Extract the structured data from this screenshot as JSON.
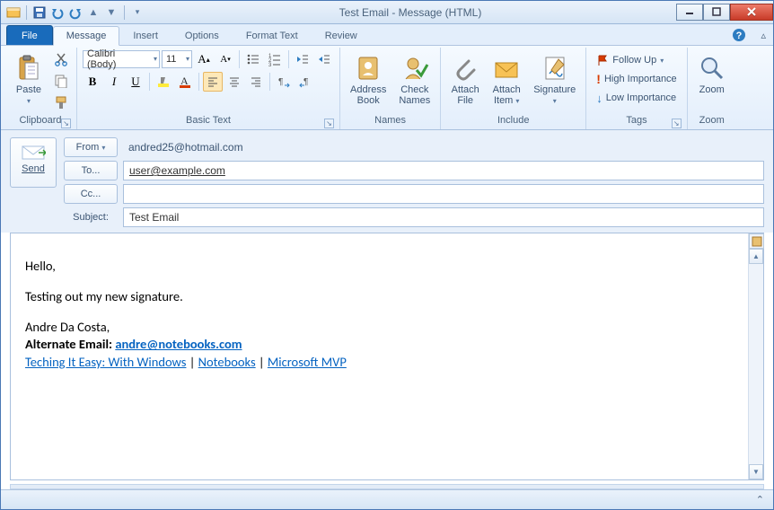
{
  "window": {
    "title": "Test Email  -  Message (HTML)"
  },
  "tabs": {
    "file": "File",
    "list": [
      "Message",
      "Insert",
      "Options",
      "Format Text",
      "Review"
    ],
    "active": 0
  },
  "ribbon": {
    "clipboard": {
      "label": "Clipboard",
      "paste": "Paste"
    },
    "basictext": {
      "label": "Basic Text",
      "font": "Calibri (Body)",
      "size": "11"
    },
    "names": {
      "label": "Names",
      "address": "Address\nBook",
      "check": "Check\nNames"
    },
    "include": {
      "label": "Include",
      "attachfile": "Attach\nFile",
      "attachitem": "Attach\nItem",
      "signature": "Signature"
    },
    "tags": {
      "label": "Tags",
      "followup": "Follow Up",
      "high": "High Importance",
      "low": "Low Importance"
    },
    "zoom": {
      "label": "Zoom",
      "zoom": "Zoom"
    }
  },
  "header": {
    "send": "Send",
    "from_label": "From",
    "from_value": "andred25@hotmail.com",
    "to_label": "To...",
    "to_value": "user@example.com",
    "cc_label": "Cc...",
    "cc_value": "",
    "subject_label": "Subject:",
    "subject_value": "Test Email"
  },
  "body": {
    "line1": "Hello,",
    "line2": "Testing out my new signature.",
    "sig_name": "Andre Da Costa,",
    "alt_label": "Alternate Email: ",
    "alt_email": "andre@notebooks.com",
    "link1": "Teching It Easy: With Windows",
    "sep": " | ",
    "link2": "Notebooks",
    "link3": "Microsoft MVP"
  }
}
